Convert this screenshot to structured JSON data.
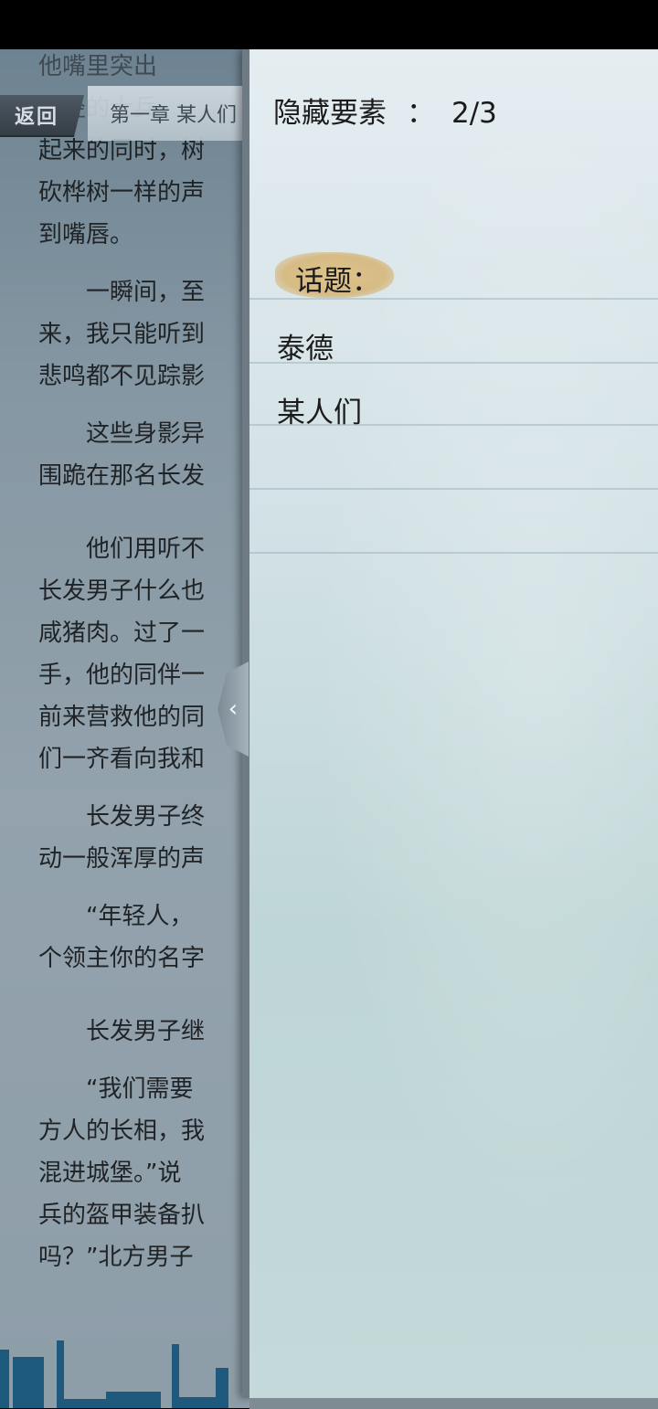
{
  "reader": {
    "back_label": "返回",
    "chapter_title": "第一章  某人们",
    "text_lines": [
      "他嘴里突出",
      "年轻的士兵",
      "起来的同时，树",
      "砍桦树一样的声",
      "到嘴唇。",
      "",
      "　　一瞬间，至",
      "来，我只能听到",
      "悲鸣都不见踪影",
      "",
      "　　这些身影异",
      "围跪在那名长发",
      "",
      "",
      "　　他们用听不",
      "长发男子什么也",
      "咸猪肉。过了一",
      "手，他的同伴一",
      "前来营救他的同",
      "们一齐看向我和",
      "",
      "　　长发男子终",
      "动一般浑厚的声",
      "",
      "　　“年轻人，",
      "个领主你的名字",
      "",
      "",
      "　　长发男子继",
      "",
      "　　“我们需要",
      "方人的长相，我",
      "混进城堡。”说",
      "兵的盔甲装备扒",
      "吗？”北方男子"
    ]
  },
  "panel": {
    "hidden_label": "隐藏要素",
    "separator": "：",
    "hidden_count": "2/3",
    "topic_label": "话题：",
    "topics": [
      "泰德",
      "某人们"
    ]
  },
  "colors": {
    "panel_bg": "#d2e1e5",
    "topic_highlight": "#d6bb84",
    "text": "#1b1b1b",
    "skyline": "#1d5a7e"
  },
  "icons": {
    "collapse_handle": "chevron-left-icon"
  }
}
